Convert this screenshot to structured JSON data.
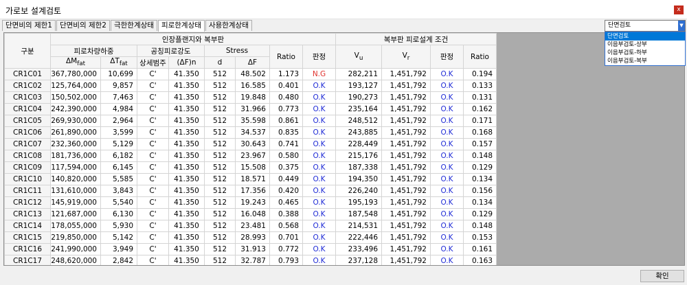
{
  "window": {
    "title": "가로보 설계검토",
    "close_label": "x"
  },
  "tabs": [
    "단면비의 제한1",
    "단면비의 제한2",
    "극한한계상태",
    "피로한계상태",
    "사용한계상태"
  ],
  "combo": {
    "selected": "단면검토",
    "options": [
      "단면검토",
      "이음부검토-상부",
      "이음부검토-하부",
      "이음부검토-복부"
    ]
  },
  "headers": {
    "group": "구분",
    "flange": "인장플랜지와 복부판",
    "fatigue_load": "피로차량하중",
    "dm": "ΔM",
    "dm_sub": "fat",
    "dt": "ΔT",
    "dt_sub": "fat",
    "strength": "공칭피로강도",
    "category": "상세범주",
    "dfn": "(ΔF)n",
    "stress": "Stress",
    "d": "d",
    "df": "ΔF",
    "ratio": "Ratio",
    "judge": "판정",
    "web": "복부판 피로설계 조건",
    "vu": "V",
    "vu_sub": "u",
    "vr": "V",
    "vr_sub": "r",
    "judge2": "판정",
    "ratio2": "Ratio"
  },
  "rows": [
    [
      "CR1C01",
      "367,780,000",
      "10,699",
      "C'",
      "41.350",
      "512",
      "48.502",
      "1.173",
      "N.G",
      "282,211",
      "1,451,792",
      "O.K",
      "0.194"
    ],
    [
      "CR1C02",
      "125,764,000",
      "9,857",
      "C'",
      "41.350",
      "512",
      "16.585",
      "0.401",
      "O.K",
      "193,127",
      "1,451,792",
      "O.K",
      "0.133"
    ],
    [
      "CR1C03",
      "150,502,000",
      "7,463",
      "C'",
      "41.350",
      "512",
      "19.848",
      "0.480",
      "O.K",
      "190,273",
      "1,451,792",
      "O.K",
      "0.131"
    ],
    [
      "CR1C04",
      "242,390,000",
      "4,984",
      "C'",
      "41.350",
      "512",
      "31.966",
      "0.773",
      "O.K",
      "235,164",
      "1,451,792",
      "O.K",
      "0.162"
    ],
    [
      "CR1C05",
      "269,930,000",
      "2,964",
      "C'",
      "41.350",
      "512",
      "35.598",
      "0.861",
      "O.K",
      "248,512",
      "1,451,792",
      "O.K",
      "0.171"
    ],
    [
      "CR1C06",
      "261,890,000",
      "3,599",
      "C'",
      "41.350",
      "512",
      "34.537",
      "0.835",
      "O.K",
      "243,885",
      "1,451,792",
      "O.K",
      "0.168"
    ],
    [
      "CR1C07",
      "232,360,000",
      "5,129",
      "C'",
      "41.350",
      "512",
      "30.643",
      "0.741",
      "O.K",
      "228,449",
      "1,451,792",
      "O.K",
      "0.157"
    ],
    [
      "CR1C08",
      "181,736,000",
      "6,182",
      "C'",
      "41.350",
      "512",
      "23.967",
      "0.580",
      "O.K",
      "215,176",
      "1,451,792",
      "O.K",
      "0.148"
    ],
    [
      "CR1C09",
      "117,594,000",
      "6,145",
      "C'",
      "41.350",
      "512",
      "15.508",
      "0.375",
      "O.K",
      "187,338",
      "1,451,792",
      "O.K",
      "0.129"
    ],
    [
      "CR1C10",
      "140,820,000",
      "5,585",
      "C'",
      "41.350",
      "512",
      "18.571",
      "0.449",
      "O.K",
      "194,350",
      "1,451,792",
      "O.K",
      "0.134"
    ],
    [
      "CR1C11",
      "131,610,000",
      "3,843",
      "C'",
      "41.350",
      "512",
      "17.356",
      "0.420",
      "O.K",
      "226,240",
      "1,451,792",
      "O.K",
      "0.156"
    ],
    [
      "CR1C12",
      "145,919,000",
      "5,540",
      "C'",
      "41.350",
      "512",
      "19.243",
      "0.465",
      "O.K",
      "195,193",
      "1,451,792",
      "O.K",
      "0.134"
    ],
    [
      "CR1C13",
      "121,687,000",
      "6,130",
      "C'",
      "41.350",
      "512",
      "16.048",
      "0.388",
      "O.K",
      "187,548",
      "1,451,792",
      "O.K",
      "0.129"
    ],
    [
      "CR1C14",
      "178,055,000",
      "5,930",
      "C'",
      "41.350",
      "512",
      "23.481",
      "0.568",
      "O.K",
      "214,531",
      "1,451,792",
      "O.K",
      "0.148"
    ],
    [
      "CR1C15",
      "219,850,000",
      "5,142",
      "C'",
      "41.350",
      "512",
      "28.993",
      "0.701",
      "O.K",
      "222,446",
      "1,451,792",
      "O.K",
      "0.153"
    ],
    [
      "CR1C16",
      "241,990,000",
      "3,949",
      "C'",
      "41.350",
      "512",
      "31.913",
      "0.772",
      "O.K",
      "233,496",
      "1,451,792",
      "O.K",
      "0.161"
    ],
    [
      "CR1C17",
      "248,620,000",
      "2,842",
      "C'",
      "41.350",
      "512",
      "32.787",
      "0.793",
      "O.K",
      "237,128",
      "1,451,792",
      "O.K",
      "0.163"
    ]
  ],
  "confirm_label": "확인",
  "colors": {
    "ok": "#1f2bd6",
    "ng": "#e0302c",
    "selection": "#0078d7",
    "grid_empty": "#ababab"
  }
}
